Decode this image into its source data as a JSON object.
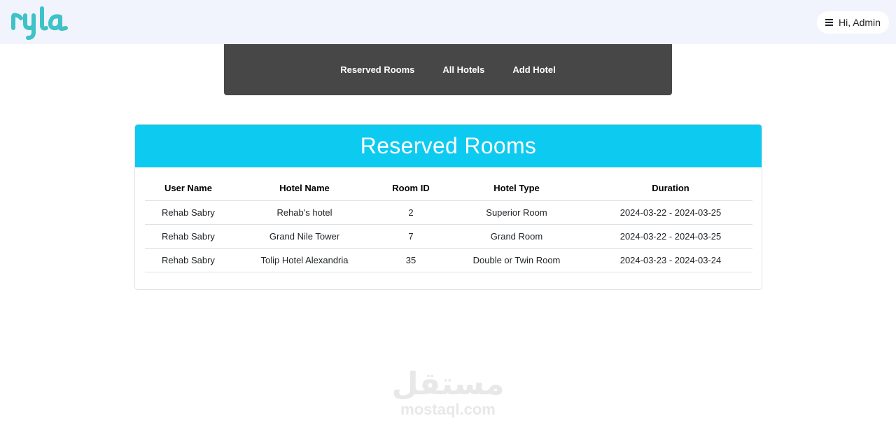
{
  "brand": {
    "logo_text": "ryla",
    "accent": "#3ec2c8"
  },
  "header": {
    "user_label": "Hi, Admin",
    "menu_icon": "hamburger-icon"
  },
  "nav": {
    "items": [
      {
        "label": "Reserved Rooms"
      },
      {
        "label": "All Hotels"
      },
      {
        "label": "Add Hotel"
      }
    ]
  },
  "main": {
    "title": "Reserved Rooms",
    "header_color": "#0dcaf0",
    "columns": [
      "User Name",
      "Hotel Name",
      "Room ID",
      "Hotel Type",
      "Duration"
    ],
    "rows": [
      [
        "Rehab Sabry",
        "Rehab's hotel",
        "2",
        "Superior Room",
        "2024-03-22 - 2024-03-25"
      ],
      [
        "Rehab Sabry",
        "Grand Nile Tower",
        "7",
        "Grand Room",
        "2024-03-22 - 2024-03-25"
      ],
      [
        "Rehab Sabry",
        "Tolip Hotel Alexandria",
        "35",
        "Double or Twin Room",
        "2024-03-23 - 2024-03-24"
      ]
    ]
  },
  "watermark": {
    "arabic": "مستقل",
    "latin": "mostaql.com"
  }
}
